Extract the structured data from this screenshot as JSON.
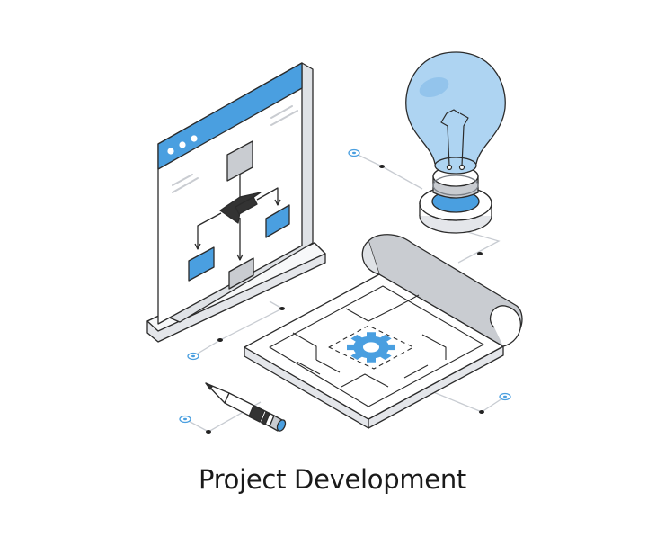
{
  "caption": "Project Development",
  "colors": {
    "accent": "#4a9fe0",
    "accent_light": "#aed4f2",
    "outline": "#2b2b2b",
    "gray": "#c9ccd1",
    "dark": "#333333",
    "shadow": "#eceef1"
  },
  "icons": [
    "browser-window",
    "flowchart",
    "light-bulb",
    "blueprint-scroll",
    "gear",
    "pencil"
  ]
}
